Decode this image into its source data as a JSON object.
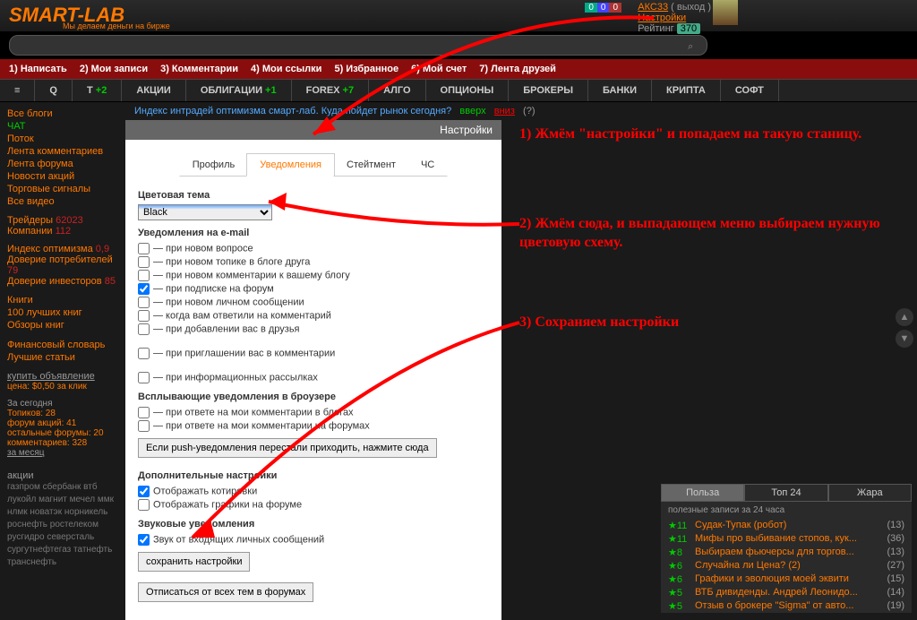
{
  "header": {
    "logo": "SMART-LAB",
    "slogan": "Мы делаем деньги на бирже",
    "user": "АКС33",
    "logout": "( выход )",
    "settings_link": "Настройки",
    "rating_label": "Рейтинг",
    "rating_value": "370",
    "badges": [
      "0",
      "0",
      "0"
    ]
  },
  "search": {
    "placeholder": ""
  },
  "rednav": [
    "1) Написать",
    "2) Мои записи",
    "3) Комментарии",
    "4) Мои ссылки",
    "5) Избранное",
    "6) Мой счет",
    "7) Лента друзей"
  ],
  "mainnav": [
    {
      "t": "≡"
    },
    {
      "t": "Q"
    },
    {
      "t": "T",
      "plus": "+2"
    },
    {
      "t": "АКЦИИ"
    },
    {
      "t": "ОБЛИГАЦИИ",
      "plus": "+1"
    },
    {
      "t": "FOREX",
      "plus": "+7"
    },
    {
      "t": "АЛГО"
    },
    {
      "t": "ОПЦИОНЫ"
    },
    {
      "t": "БРОКЕРЫ"
    },
    {
      "t": "БАНКИ"
    },
    {
      "t": "КРИПТА"
    },
    {
      "t": "СОФТ"
    }
  ],
  "left": {
    "blogs": [
      "Все блоги",
      "ЧАТ",
      "Поток",
      "Лента комментариев",
      "Лента форума",
      "Новости акций",
      "Торговые сигналы",
      "Все видео"
    ],
    "traders": {
      "l": "Трейдеры",
      "v": "62023"
    },
    "companies": {
      "l": "Компании",
      "v": "112"
    },
    "idx": {
      "l": "Индекс оптимизма",
      "v": "0,9"
    },
    "dov1": {
      "l": "Доверие потребителей",
      "v": "79"
    },
    "dov2": {
      "l": "Доверие инвесторов",
      "v": "85"
    },
    "books_h": "Книги",
    "books": [
      "100 лучших книг",
      "Обзоры книг"
    ],
    "fin": [
      "Финансовый словарь",
      "Лучшие статьи"
    ],
    "buy": "купить объявление",
    "price": "цена: $0,50 за клик",
    "today_h": "За сегодня",
    "today": [
      "Топиков: 28",
      "форум акций: 41",
      "остальные форумы: 20",
      "комментариев: 328"
    ],
    "month": "за месяц",
    "tags_h": "акции",
    "tags": "газпром сбербанк втб лукойл магнит мечел ммк нлмк новатэк норникель роснефть ростелеком русгидро северсталь сургутнефтегаз татнефть транснефть"
  },
  "topic": {
    "text": "Индекс интрадей оптимизма смарт-лаб. Куда пойдет рынок сегодня?",
    "up": "вверх",
    "down": "вниз",
    "q": "(?)"
  },
  "settings": {
    "title": "Настройки",
    "tabs": [
      "Профиль",
      "Уведомления",
      "Стейтмент",
      "ЧС"
    ],
    "active_tab": 1,
    "theme_label": "Цветовая тема",
    "theme_value": "Black",
    "email_h": "Уведомления на e-mail",
    "email_opts": [
      {
        "t": "— при новом вопросе",
        "c": false
      },
      {
        "t": "— при новом топике в блоге друга",
        "c": false
      },
      {
        "t": "— при новом комментарии к вашему блогу",
        "c": false
      },
      {
        "t": "— при подписке на форум",
        "c": true
      },
      {
        "t": "— при новом личном сообщении",
        "c": false
      },
      {
        "t": "— когда вам ответили на комментарий",
        "c": false
      },
      {
        "t": "— при добавлении вас в друзья",
        "c": false
      }
    ],
    "invite_opt": {
      "t": "— при приглашении вас в комментарии",
      "c": false
    },
    "info_opt": {
      "t": "— при информационных рассылках",
      "c": false
    },
    "popup_h": "Всплывающие уведомления в броузере",
    "popup_opts": [
      {
        "t": "— при ответе на мои комментарии в блогах",
        "c": false
      },
      {
        "t": "— при ответе на мои комментарии на форумах",
        "c": false
      }
    ],
    "push_btn": "Если push-уведомления перестали приходить, нажмите сюда",
    "extra_h": "Дополнительные настройки",
    "extra_opts": [
      {
        "t": "Отображать котировки",
        "c": true
      },
      {
        "t": "Отображать графики на форуме",
        "c": false
      }
    ],
    "sound_h": "Звуковые уведомления",
    "sound_opts": [
      {
        "t": "Звук от входящих личных сообщений",
        "c": true
      }
    ],
    "save_btn": "сохранить настройки",
    "unsub_btn": "Отписаться от всех тем в форумах"
  },
  "annotations": {
    "a1": "1) Жмём \"настройки\" и попадаем на такую станицу.",
    "a2": "2) Жмём сюда, и выпадающем меню выбираем нужную цветовую схему.",
    "a3": "3) Сохраняем настройки"
  },
  "rightbox": {
    "tabs": [
      "Польза",
      "Топ 24",
      "Жара"
    ],
    "head": "полезные записи за 24 часа",
    "items": [
      {
        "s": "★11",
        "t": "Судак-Тупак (робот)",
        "c": "(13)"
      },
      {
        "s": "★11",
        "t": "Мифы про выбивание стопов, кук...",
        "c": "(36)"
      },
      {
        "s": "★8",
        "t": "Выбираем фьючерсы для торгов...",
        "c": "(13)"
      },
      {
        "s": "★6",
        "t": "Случайна ли Цена? (2)",
        "c": "(27)"
      },
      {
        "s": "★6",
        "t": "Графики и эволюция моей эквити",
        "c": "(15)"
      },
      {
        "s": "★5",
        "t": "ВТБ дивиденды. Андрей Леонидо...",
        "c": "(14)"
      },
      {
        "s": "★5",
        "t": "Отзыв о брокере \"Sigma\" от авто...",
        "c": "(19)"
      }
    ]
  }
}
